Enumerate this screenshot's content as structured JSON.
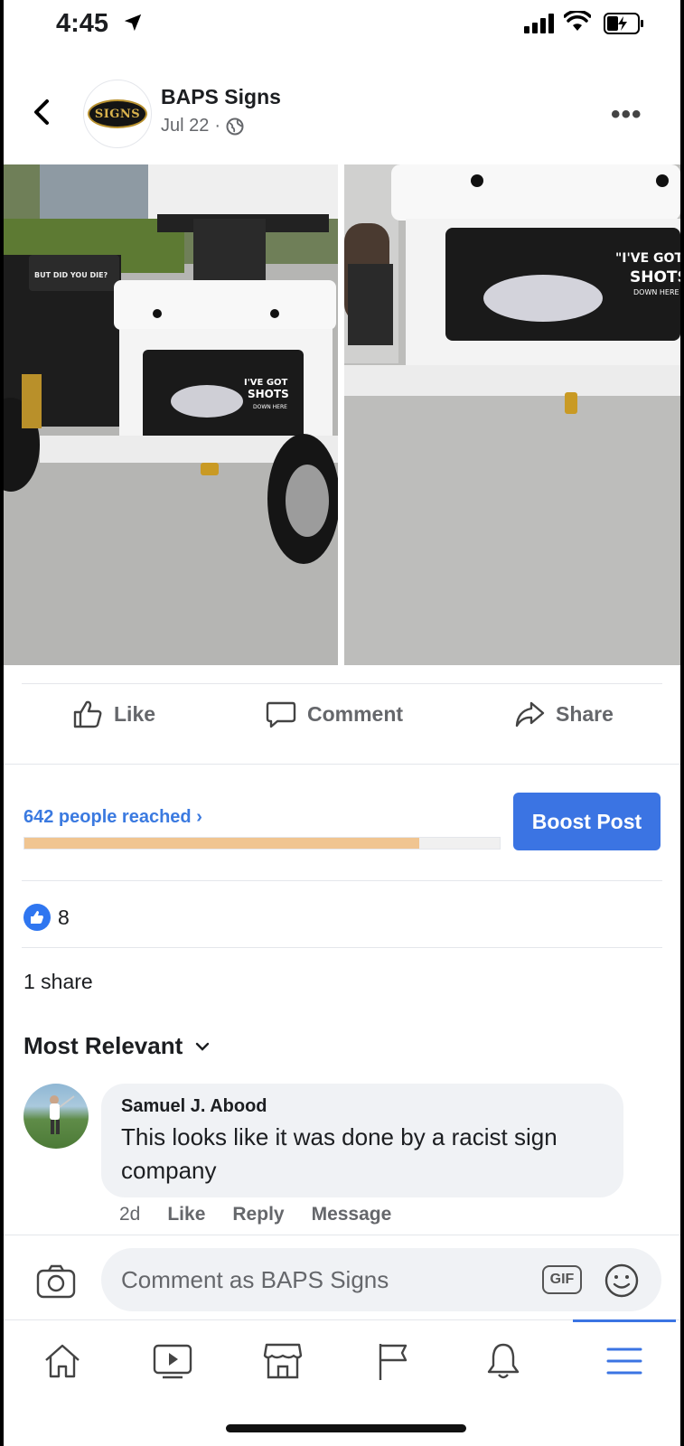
{
  "status_bar": {
    "time": "4:45",
    "location_icon": "location-arrow-icon",
    "signal_icon": "cellular-signal-icon",
    "wifi_icon": "wifi-icon",
    "battery_icon": "battery-charging-icon"
  },
  "post": {
    "page_name": "BAPS Signs",
    "date": "Jul 22",
    "separator": "·",
    "privacy_icon": "globe-icon",
    "logo_text": "SIGNS",
    "photos": [
      {
        "description_icon": "cooler-photo",
        "sticker_text": [
          "I'VE GOT",
          "SHOTS",
          "DOWN HERE"
        ],
        "engine_text": [
          "BUT DID",
          "YOU DIE?"
        ]
      },
      {
        "description_icon": "cooler-closeup-photo",
        "sticker_text": [
          "I'VE GOT",
          "SHOTS",
          "DOWN HERE"
        ]
      }
    ]
  },
  "actions": {
    "like": "Like",
    "comment": "Comment",
    "share": "Share"
  },
  "insights": {
    "reach_text": "642 people reached",
    "reach_chevron": "›",
    "progress_fraction": 0.83,
    "boost_label": "Boost Post"
  },
  "reactions": {
    "like_count": "8",
    "shares": "1 share"
  },
  "comments": {
    "sort_label": "Most Relevant",
    "items": [
      {
        "author": "Samuel J. Abood",
        "text": "This looks like it was done by a racist sign company",
        "time": "2d",
        "like": "Like",
        "reply": "Reply",
        "message": "Message"
      }
    ]
  },
  "composer": {
    "placeholder": "Comment as BAPS Signs",
    "gif_label": "GIF"
  },
  "tabbar": {
    "items": [
      "home-icon",
      "video-icon",
      "marketplace-icon",
      "pages-flag-icon",
      "notifications-bell-icon",
      "menu-icon"
    ],
    "active_index": 5
  },
  "colors": {
    "accent_blue": "#3b74e3",
    "progress_fill": "#f0c591",
    "link_blue": "#3b7ae0"
  }
}
